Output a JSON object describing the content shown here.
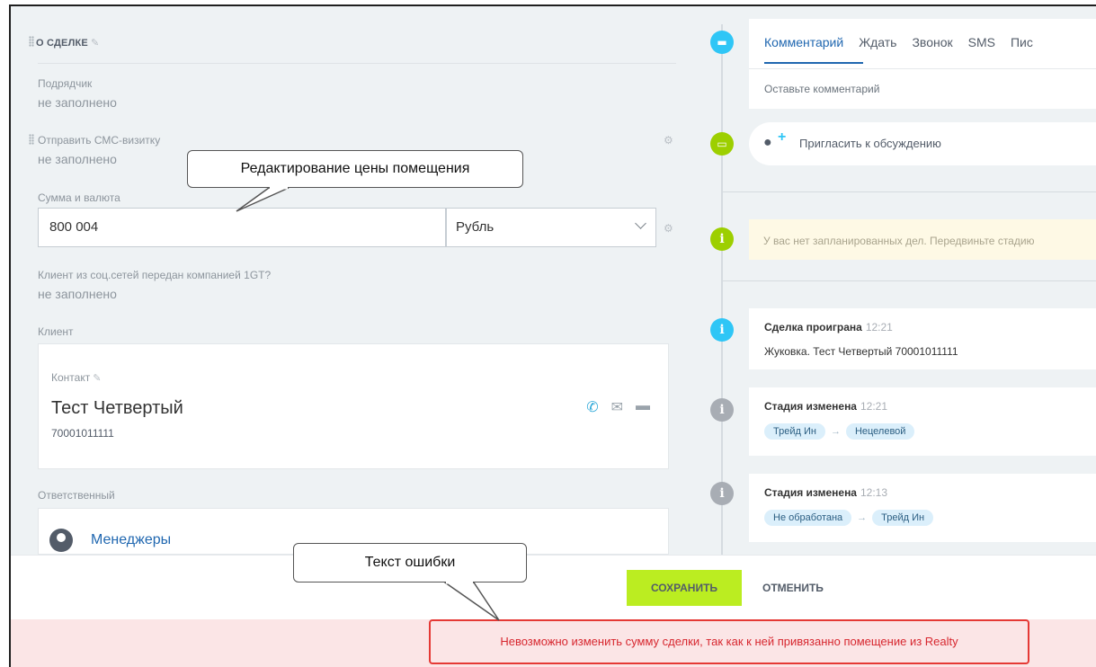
{
  "deal": {
    "section_title": "О СДЕЛКЕ",
    "fields": {
      "contractor": {
        "label": "Подрядчик",
        "value": "не заполнено"
      },
      "sms": {
        "label": "Отправить СМС-визитку",
        "value": "не заполнено"
      },
      "sum": {
        "label": "Сумма и валюта",
        "amount": "800 004",
        "currency": "Рубль"
      },
      "social": {
        "label": "Клиент из соц.сетей передан компанией 1GT?",
        "value": "не заполнено"
      },
      "client_label": "Клиент",
      "responsible_label": "Ответственный"
    },
    "contact": {
      "label": "Контакт",
      "name": "Тест Четвертый",
      "phone": "70001011111"
    },
    "responsible": {
      "name": "Менеджеры"
    }
  },
  "timeline": {
    "tabs": [
      "Комментарий",
      "Ждать",
      "Звонок",
      "SMS",
      "Пис"
    ],
    "active_tab": "Комментарий",
    "comment_placeholder": "Оставьте комментарий",
    "invite": "Пригласить к обсуждению",
    "planned_text": "У вас нет запланированных дел. Передвиньте стадию",
    "events": [
      {
        "title": "Сделка проиграна",
        "time": "12:21",
        "text": "Жуковка. Тест Четвертый 70001011111"
      },
      {
        "title": "Стадия изменена",
        "time": "12:21",
        "from": "Трейд Ин",
        "to": "Нецелевой"
      },
      {
        "title": "Стадия изменена",
        "time": "12:13",
        "from": "Не обработана",
        "to": "Трейд Ин"
      }
    ]
  },
  "footer": {
    "save": "СОХРАНИТЬ",
    "cancel": "ОТМЕНИТЬ"
  },
  "error": {
    "text": "Невозможно изменить сумму сделки, так как к ней привязанно помещение из Realty"
  },
  "callouts": {
    "price_edit": "Редактирование цены помещения",
    "error_text": "Текст ошибки"
  },
  "colors": {
    "accent_blue": "#2067b0",
    "save_green": "#bbed21",
    "error_red": "#e53935",
    "icon_cyan": "#2fc6f6",
    "icon_green": "#9dcf00",
    "icon_gray": "#a8adb4"
  }
}
